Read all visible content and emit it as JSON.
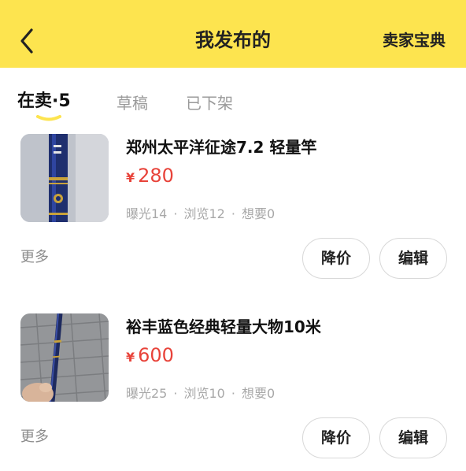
{
  "header": {
    "title": "我发布的",
    "guide_label": "卖家宝典",
    "back_icon": "chevron-left-icon",
    "bg_color": "#fde44f"
  },
  "tabs": [
    {
      "label": "在卖",
      "count": "·5",
      "active": true
    },
    {
      "label": "草稿",
      "active": false
    },
    {
      "label": "已下架",
      "active": false
    }
  ],
  "items": [
    {
      "name": "郑州太平洋征途7.2 轻量竿",
      "currency": "¥",
      "price": "280",
      "stats": {
        "exposure": "曝光14",
        "views": "浏览12",
        "wants": "想要0"
      },
      "more_label": "更多",
      "reduce_label": "降价",
      "edit_label": "编辑"
    },
    {
      "name": "裕丰蓝色经典轻量大物10米",
      "currency": "¥",
      "price": "600",
      "stats": {
        "exposure": "曝光25",
        "views": "浏览10",
        "wants": "想要0"
      },
      "more_label": "更多",
      "reduce_label": "降价",
      "edit_label": "编辑"
    }
  ],
  "colors": {
    "accent": "#fde44f",
    "price": "#e8433a"
  }
}
